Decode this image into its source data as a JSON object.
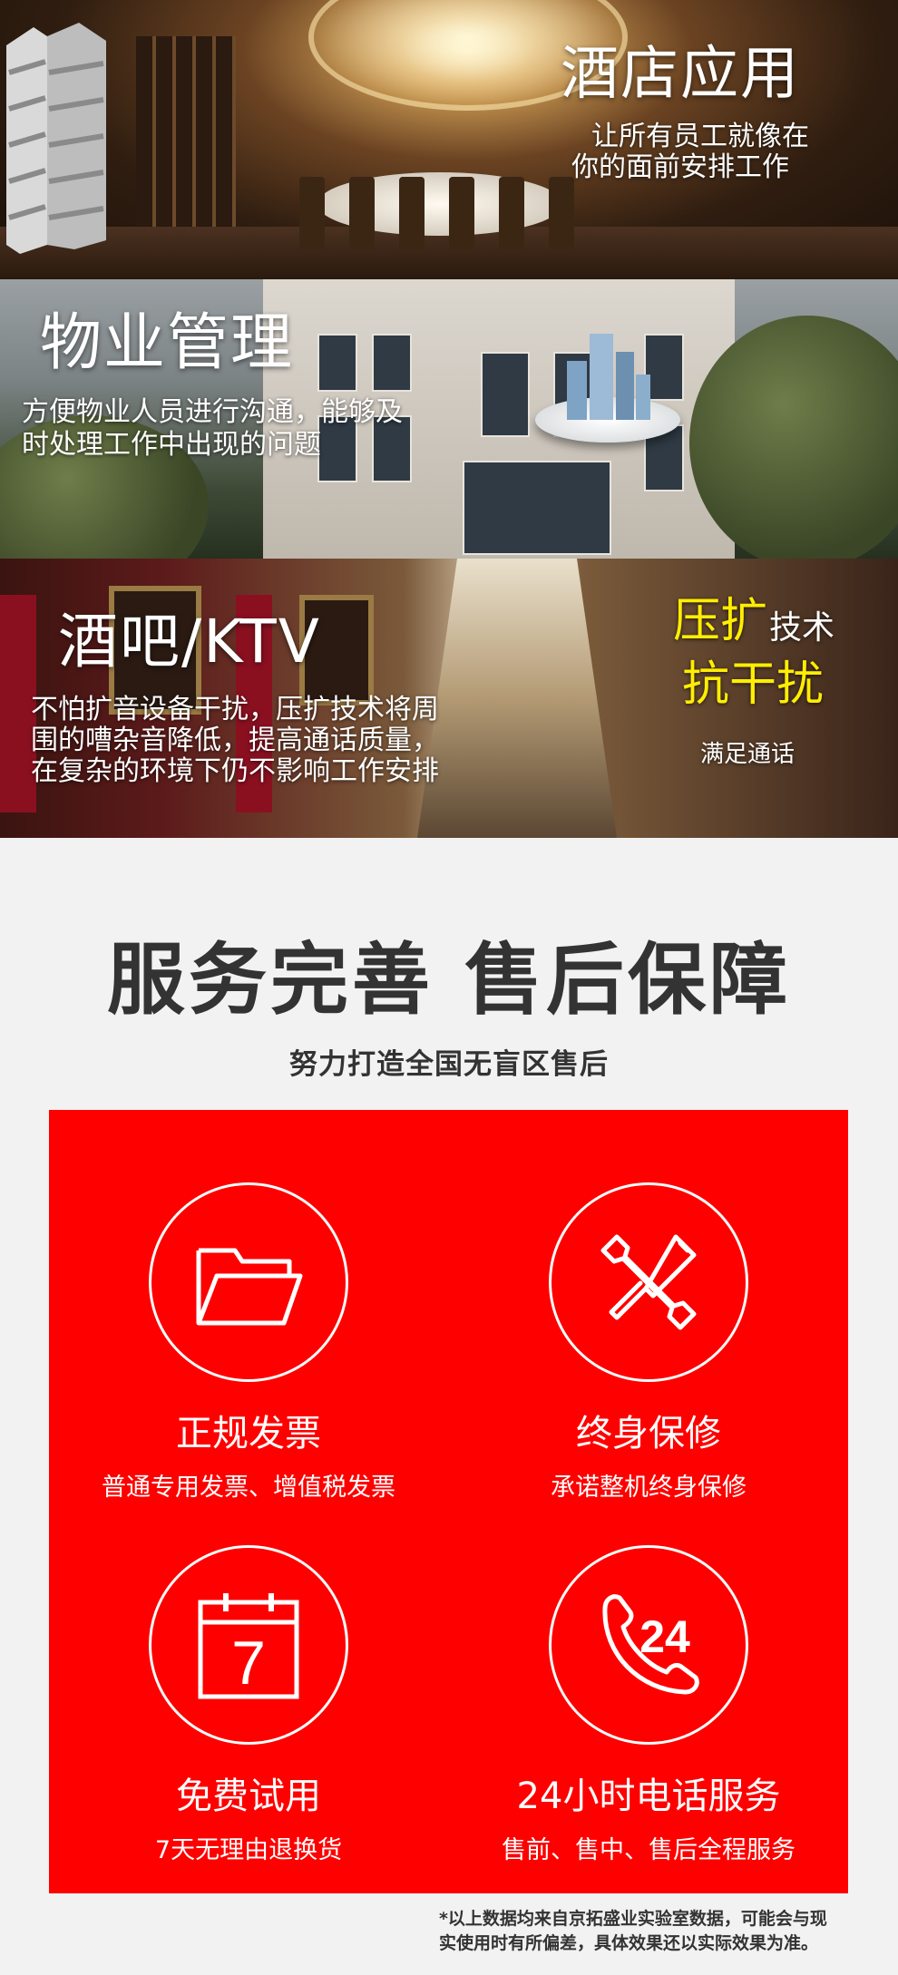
{
  "banners": [
    {
      "title": "酒店应用",
      "desc_line1": "让所有员工就像在",
      "desc_line2": "你的面前安排工作"
    },
    {
      "title": "物业管理",
      "desc_line1": "方便物业人员进行沟通，能够及",
      "desc_line2": "时处理工作中出现的问题"
    },
    {
      "title": "酒吧/KTV",
      "desc_line1": "不怕扩音设备干扰，压扩技术将周",
      "desc_line2": "围的嘈杂音降低，提高通话质量，",
      "desc_line3": "在复杂的环境下仍不影响工作安排",
      "tag_highlight": "压扩",
      "tag_rest": "技术",
      "tag2": "抗干扰",
      "tag3": "满足通话"
    }
  ],
  "service": {
    "title": "服务完善  售后保障",
    "subtitle": "努力打造全国无盲区售后",
    "features": [
      {
        "icon": "folder-icon",
        "title": "正规发票",
        "desc": "普通专用发票、增值税发票"
      },
      {
        "icon": "wrench-screwdriver-icon",
        "title": "终身保修",
        "desc": "承诺整机终身保修"
      },
      {
        "icon": "calendar-icon",
        "icon_text": "7",
        "title": "免费试用",
        "desc": "7天无理由退换货"
      },
      {
        "icon": "phone-24-icon",
        "icon_text": "24",
        "title": "24小时电话服务",
        "desc": "售前、售中、售后全程服务"
      }
    ]
  },
  "footnote_line1": "*以上数据均来自京拓盛业实验室数据，可能会与现",
  "footnote_line2": "实使用时有所偏差，具体效果还以实际效果为准。",
  "colors": {
    "accent_red": "#ff0000",
    "highlight_yellow": "#ffee00",
    "heading_dark": "#333333"
  }
}
